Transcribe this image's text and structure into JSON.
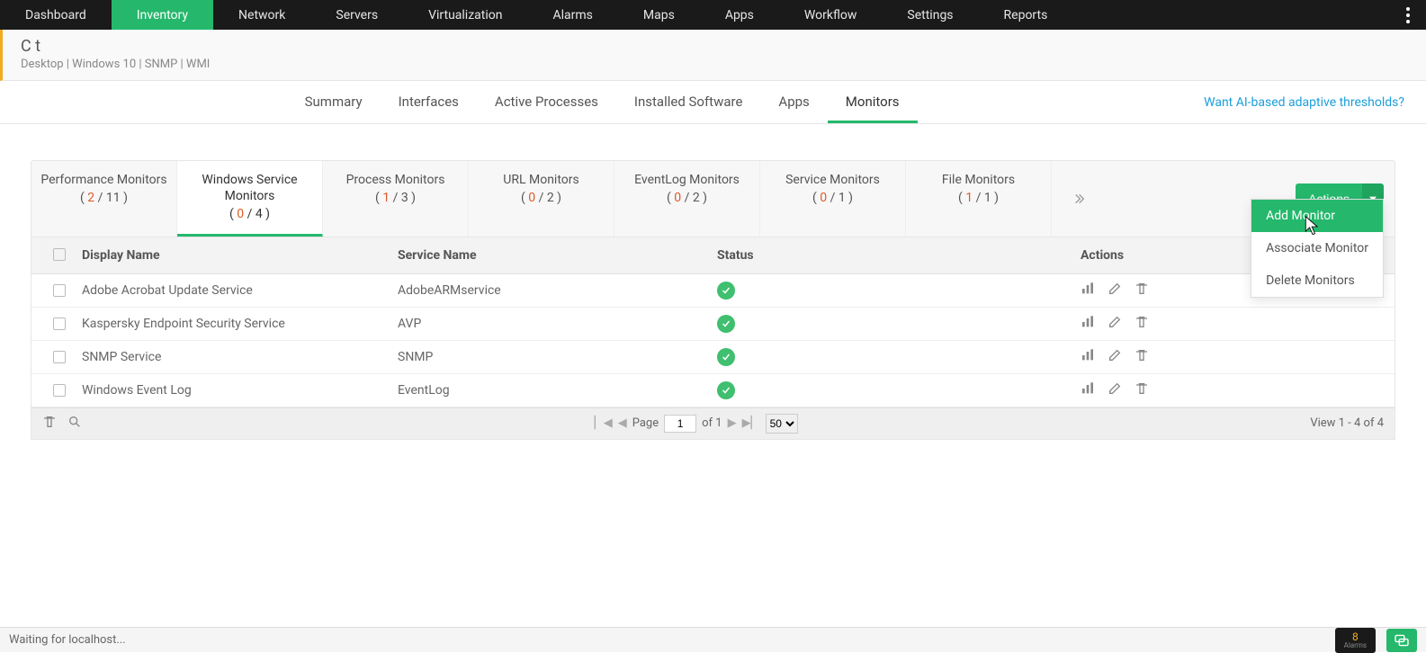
{
  "topnav": {
    "items": [
      "Dashboard",
      "Inventory",
      "Network",
      "Servers",
      "Virtualization",
      "Alarms",
      "Maps",
      "Apps",
      "Workflow",
      "Settings",
      "Reports"
    ],
    "active_index": 1
  },
  "device": {
    "title": "C                                t",
    "subtitle": "Desktop | Windows 10  | SNMP  | WMI"
  },
  "subtabs": {
    "items": [
      "Summary",
      "Interfaces",
      "Active Processes",
      "Installed Software",
      "Apps",
      "Monitors"
    ],
    "active_index": 5,
    "ai_link": "Want AI-based adaptive thresholds?"
  },
  "monitor_types": [
    {
      "label": "Performance Monitors",
      "critical": "2",
      "total": "11"
    },
    {
      "label": "Windows Service Monitors",
      "critical": "0",
      "total": "4"
    },
    {
      "label": "Process Monitors",
      "critical": "1",
      "total": "3"
    },
    {
      "label": "URL Monitors",
      "critical": "0",
      "total": "2"
    },
    {
      "label": "EventLog Monitors",
      "critical": "0",
      "total": "2"
    },
    {
      "label": "Service Monitors",
      "critical": "0",
      "total": "1"
    },
    {
      "label": "File Monitors",
      "critical": "1",
      "total": "1"
    }
  ],
  "monitor_types_active_index": 1,
  "actions_button": "Actions",
  "actions_menu": {
    "items": [
      "Add Monitor",
      "Associate Monitor",
      "Delete Monitors"
    ],
    "highlighted_index": 0
  },
  "table": {
    "headers": {
      "display_name": "Display Name",
      "service_name": "Service Name",
      "status": "Status",
      "actions": "Actions"
    },
    "rows": [
      {
        "display_name": "Adobe Acrobat Update Service",
        "service_name": "AdobeARMservice",
        "status": "ok"
      },
      {
        "display_name": "Kaspersky Endpoint Security Service",
        "service_name": "AVP",
        "status": "ok"
      },
      {
        "display_name": "SNMP Service",
        "service_name": "SNMP",
        "status": "ok"
      },
      {
        "display_name": "Windows Event Log",
        "service_name": "EventLog",
        "status": "ok"
      }
    ],
    "footer": {
      "page_label": "Page",
      "page": "1",
      "of_label": "of 1",
      "per_page": "50",
      "view_text": "View 1 - 4 of 4"
    }
  },
  "statusbar": {
    "text": "Waiting for localhost...",
    "alarm_count": "8",
    "alarm_label": "Alarms"
  }
}
